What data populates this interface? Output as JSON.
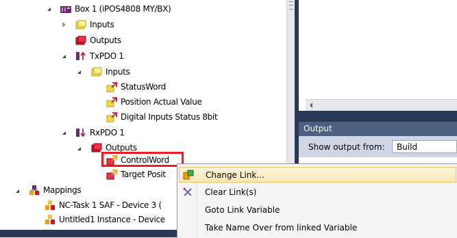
{
  "tree": {
    "nodes": [
      {
        "label": "Box 1 (iPOS4808 MY/BX)",
        "icon": "device-box-icon"
      },
      {
        "label": "Inputs",
        "icon": "inputs-folder-icon"
      },
      {
        "label": "Outputs",
        "icon": "outputs-folder-icon"
      },
      {
        "label": "TxPDO 1",
        "icon": "txpdo-icon"
      },
      {
        "label": "Inputs",
        "icon": "inputs-folder-icon"
      },
      {
        "label": "StatusWord",
        "icon": "linked-variable-icon"
      },
      {
        "label": "Position Actual Value",
        "icon": "linked-variable-icon"
      },
      {
        "label": "Digital Inputs Status 8bit",
        "icon": "linked-variable-icon"
      },
      {
        "label": "RxPDO 1",
        "icon": "rxpdo-icon"
      },
      {
        "label": "Outputs",
        "icon": "outputs-folder-icon"
      },
      {
        "label": "ControlWord",
        "icon": "linked-variable-icon"
      },
      {
        "label": "Target Posit",
        "icon": "linked-variable-icon"
      },
      {
        "label": "Mappings",
        "icon": "mappings-icon"
      },
      {
        "label": "NC-Task 1 SAF - Device 3 (",
        "icon": "mapping-item-icon"
      },
      {
        "label": "Untitled1 Instance - Device",
        "icon": "mapping-item-icon"
      }
    ]
  },
  "output": {
    "title": "Output",
    "show_from_label": "Show output from:",
    "source_selected": "Build"
  },
  "context_menu": {
    "items": [
      {
        "label": "Change Link...",
        "icon": "change-link-icon",
        "highlighted": true
      },
      {
        "label": "Clear Link(s)",
        "icon": "clear-link-icon",
        "highlighted": false
      },
      {
        "label": "Goto Link Variable",
        "icon": "",
        "highlighted": false
      },
      {
        "label": "Take Name Over from linked Variable",
        "icon": "",
        "highlighted": false
      }
    ]
  },
  "colors": {
    "dark_navy": "#293955",
    "output_header": "#4d6082",
    "highlight_red": "#ec1c24",
    "menu_hover": "#fce8b4"
  }
}
